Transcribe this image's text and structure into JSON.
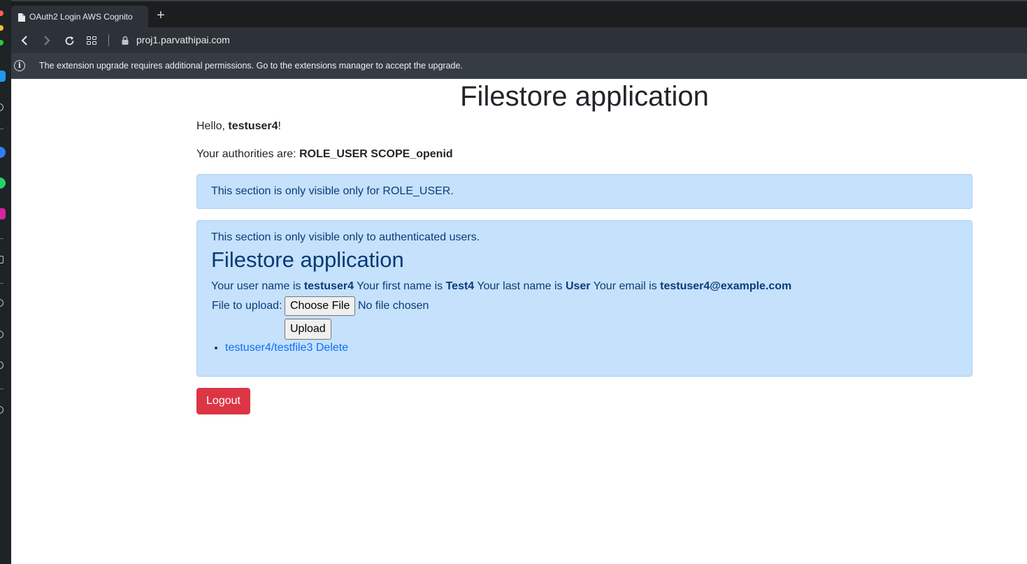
{
  "browser": {
    "tab_title": "OAuth2 Login AWS Cognito",
    "url": "proj1.parvathipai.com",
    "infobar_text": "The extension upgrade requires additional permissions. Go to the extensions manager to accept the upgrade."
  },
  "page": {
    "title": "Filestore application",
    "hello_prefix": "Hello, ",
    "username": "testuser4",
    "hello_suffix": "!",
    "authorities_label": "Your authorities are: ",
    "authorities": "ROLE_USER SCOPE_openid"
  },
  "role_section": {
    "text": "This section is only visible only for ROLE_USER."
  },
  "auth_section": {
    "text": "This section is only visible only to authenticated users.",
    "heading": "Filestore application",
    "user_name_label": "Your user name is ",
    "user_name": "testuser4",
    "first_name_label": " Your first name is ",
    "first_name": "Test4",
    "last_name_label": " Your last name is ",
    "last_name": "User",
    "email_label": " Your email is ",
    "email": "testuser4@example.com",
    "upload_label": "File to upload:",
    "choose_file_label": "Choose File",
    "no_file_text": "No file chosen",
    "upload_button": "Upload",
    "files": [
      {
        "name": "testuser4/testfile3",
        "delete_label": "Delete"
      }
    ]
  },
  "logout_label": "Logout",
  "colors": {
    "alert_bg": "#c5e1fb",
    "alert_text": "#0a3c7a",
    "link": "#0d6efd",
    "danger": "#dc3545"
  }
}
